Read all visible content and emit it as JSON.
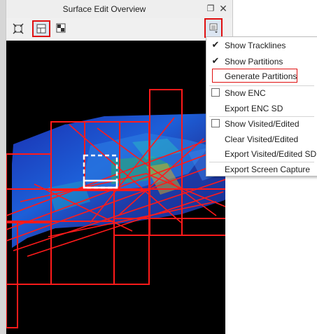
{
  "window": {
    "title": "Surface Edit Overview",
    "pin_icon": "pin-icon",
    "close_icon": "close-icon"
  },
  "toolbar": {
    "tools": [
      {
        "name": "zoom-extent-tool",
        "icon": "zoom-extent-icon",
        "selected": false
      },
      {
        "name": "partition-view-tool",
        "icon": "partition-view-icon",
        "selected": true
      },
      {
        "name": "layout-tool",
        "icon": "layout-icon",
        "selected": false
      }
    ],
    "menu_button_icon": "options-menu-icon"
  },
  "menu": {
    "items": [
      {
        "label": "Show Tracklines",
        "checkbox": true,
        "checked": true
      },
      {
        "label": "Show Partitions",
        "checkbox": true,
        "checked": true
      },
      {
        "label": "Generate Partitions",
        "checkbox": false,
        "highlighted": true
      },
      {
        "label": "Show ENC",
        "checkbox": true,
        "checked": false
      },
      {
        "label": "Export ENC SD",
        "checkbox": false
      },
      {
        "label": "Show Visited/Edited",
        "checkbox": true,
        "checked": false
      },
      {
        "label": "Clear Visited/Edited",
        "checkbox": false
      },
      {
        "label": "Export Visited/Edited SD",
        "checkbox": false
      },
      {
        "label": "Export Screen Capture",
        "checkbox": false
      }
    ]
  },
  "colors": {
    "highlight": "#e01010",
    "partition_line": "#ff1a1a",
    "viewport_bg": "#000000",
    "selection_box": "#ffffff"
  }
}
